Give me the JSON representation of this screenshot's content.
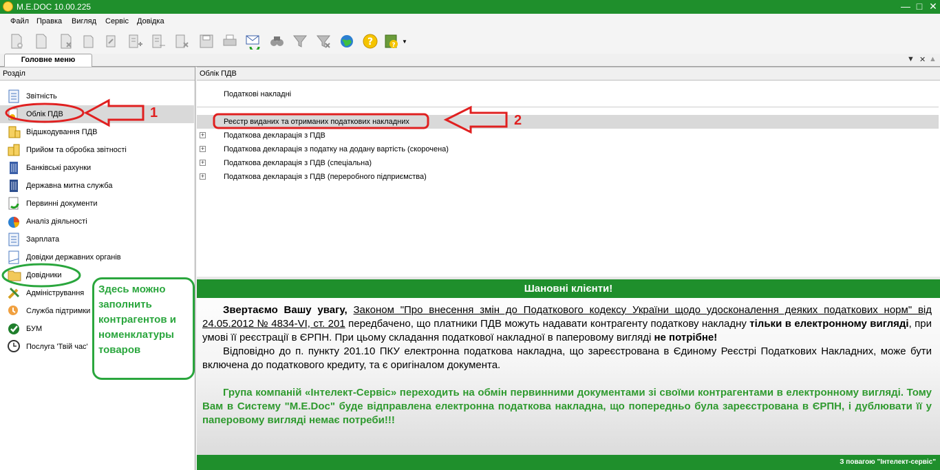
{
  "window": {
    "title": "M.E.DOC 10.00.225"
  },
  "menu": [
    "Файл",
    "Правка",
    "Вигляд",
    "Сервіс",
    "Довідка"
  ],
  "tab": {
    "label": "Головне меню"
  },
  "left_panel": {
    "header": "Розділ",
    "items": [
      {
        "label": "Звітність",
        "icon": "report-icon"
      },
      {
        "label": "Облік ПДВ",
        "icon": "vat-icon"
      },
      {
        "label": "Відшкодування ПДВ",
        "icon": "coins-icon"
      },
      {
        "label": "Прийом та обробка звітності",
        "icon": "coins-stack-icon"
      },
      {
        "label": "Банківські рахунки",
        "icon": "bank-building-icon"
      },
      {
        "label": "Державна митна служба",
        "icon": "customs-building-icon"
      },
      {
        "label": "Первинні документи",
        "icon": "primary-docs-icon"
      },
      {
        "label": "Аналіз діяльності",
        "icon": "pie-chart-icon"
      },
      {
        "label": "Зарплата",
        "icon": "salary-doc-icon"
      },
      {
        "label": "Довідки державних органів",
        "icon": "gov-doc-icon"
      },
      {
        "label": "Довідники",
        "icon": "folder-icon"
      },
      {
        "label": "Адміністрування",
        "icon": "admin-tools-icon"
      },
      {
        "label": "Служба підтримки",
        "icon": "support-icon"
      },
      {
        "label": "БУМ",
        "icon": "bum-icon"
      },
      {
        "label": "Послуга 'Твій час'",
        "icon": "clock-icon"
      }
    ]
  },
  "right_panel": {
    "header": "Облік ПДВ",
    "items": [
      {
        "label": "Податкові накладні",
        "expandable": false
      },
      {
        "label": "Реєстр виданих та отриманих податкових накладних",
        "expandable": false
      },
      {
        "label": "Податкова декларація з ПДВ",
        "expandable": true
      },
      {
        "label": "Податкова декларація з податку на додану вартість (скорочена)",
        "expandable": true
      },
      {
        "label": "Податкова декларація з ПДВ (спеціальна)",
        "expandable": true
      },
      {
        "label": "Податкова декларація з ПДВ (переробного підприємства)",
        "expandable": true
      }
    ]
  },
  "notice": {
    "header": "Шановні клієнти!",
    "p1_bold_lead": "Звертаємо Вашу увагу,",
    "p1_law": "Законом \"Про внесення змін до Податкового кодексу України щодо удосконалення деяких податкових норм\" від 24.05.2012 № 4834-VI, ст. 201",
    "p1_text": " передбачено, що платники ПДВ можуть надавати контрагенту податкову накладну ",
    "p1_bold": "тільки в електронному вигляді",
    "p1_text2": ", при умові її реєстрації в ЄРПН. При цьому складання податкової накладної в паперовому вигляді ",
    "p1_bold2": "не потрібне!",
    "p2": "Відповідно до п. пункту 201.10 ПКУ електронна податкова накладна, що зареєстрована в Єдиному Реєстрі Податкових Накладних, може бути включена до податкового кредиту, та є оригіналом документа.",
    "p3": "Група компаній «Інтелект-Сервіс» переходить на обмін первинними документами зі своїми контрагентами в електронному вигляді. Тому Вам в Систему \"M.E.Doc\" буде відправлена електронна податкова накладна, що попередньо була зареєстрована в ЄРПН, і дублювати її у паперовому вигляді немає потреби!!!",
    "footer": "З повагою \"Інтелект-сервіс\""
  },
  "annotations": {
    "marker1": "1",
    "marker2": "2",
    "green_note": "Здесь можно заполнить контрагентов и номенклатуры товаров",
    "red_color": "#e02020",
    "green_color": "#2aa63d"
  }
}
